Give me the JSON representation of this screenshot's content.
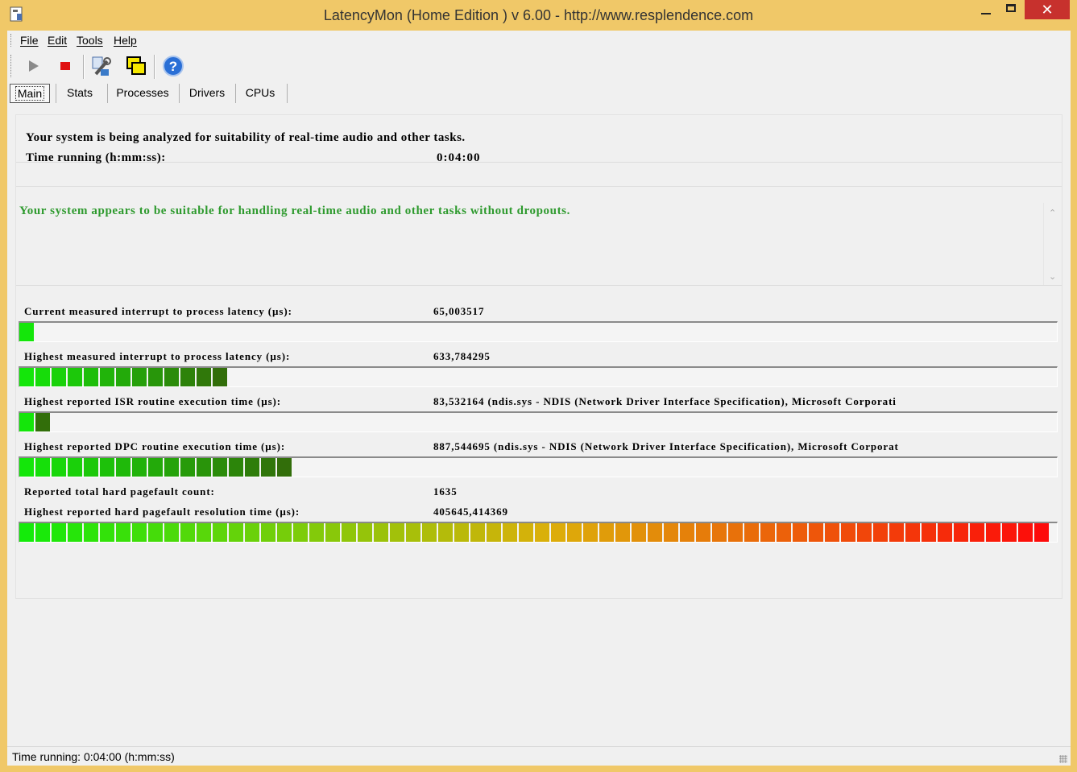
{
  "window": {
    "title": "LatencyMon  (Home Edition )  v 6.00 - http://www.resplendence.com",
    "close_glyph": "✕"
  },
  "menu": [
    "File",
    "Edit",
    "Tools",
    "Help"
  ],
  "toolbar": {
    "buttons": [
      "play-icon",
      "stop-icon",
      "wrench-icon",
      "windows-icon",
      "help-icon"
    ],
    "colors": {
      "play": "#8a8a8a",
      "stop": "#e01010",
      "help": "#2a6fd6"
    }
  },
  "tabs": [
    "Main",
    "Stats",
    "Processes",
    "Drivers",
    "CPUs"
  ],
  "analysis": {
    "line1": "Your system is being analyzed for suitability of real-time audio and other tasks.",
    "time_label": "Time running (h:mm:ss):",
    "time_value": "0:04:00"
  },
  "verdict": {
    "text": "Your system appears to be suitable for handling real-time audio and other tasks without dropouts.",
    "color": "#2e9a2e"
  },
  "metrics": [
    {
      "label": "Current measured interrupt to process latency (µs):",
      "value": "65,003517",
      "level": 0.014
    },
    {
      "label": "Highest measured interrupt to process latency (µs):",
      "value": "633,784295",
      "level": 0.185
    },
    {
      "label": "Highest reported ISR routine execution time (µs):",
      "value": "83,532164  (ndis.sys - NDIS (Network Driver Interface Specification), Microsoft Corporati",
      "level": 0.03
    },
    {
      "label": "Highest reported DPC routine execution time (µs):",
      "value": "887,544695  (ndis.sys - NDIS (Network Driver Interface Specification), Microsoft Corporat",
      "level": 0.247
    },
    {
      "label": "Reported total hard pagefault count:",
      "value": "1635"
    },
    {
      "label": "Highest reported hard pagefault resolution time (µs):",
      "value": "405645,414369",
      "level": 1.0
    }
  ],
  "statusbar": {
    "text": "Time running: 0:04:00  (h:mm:ss)"
  }
}
